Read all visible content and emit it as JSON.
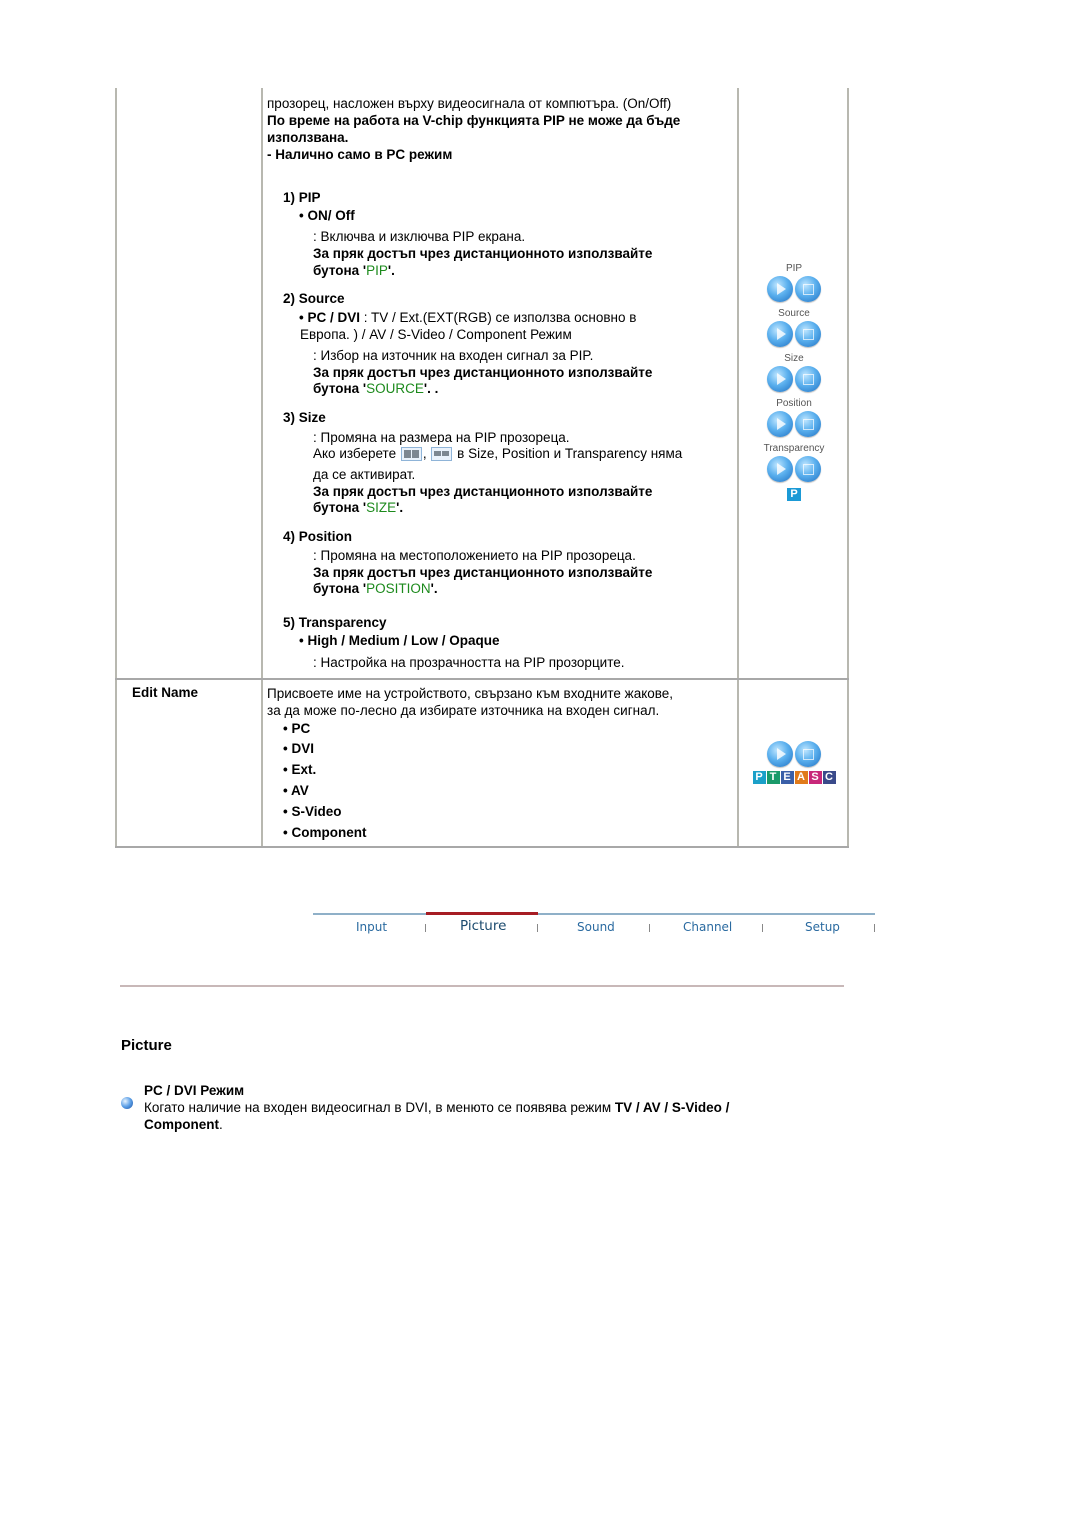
{
  "pip_row": {
    "intro_line": "прозорец, насложен върху видеосигнала от компютъра. (On/Off)",
    "warning_line1": "По време на работа на V-chip функцията PIP не може да бъде",
    "warning_line2": "използвана.",
    "pc_only": "- Налично само в PC режим",
    "sections": [
      {
        "heading": "1) PIP",
        "option": "• ON/ Off",
        "desc": ": Включва и изключва PIP екрана.",
        "remote_line1": "За пряк достъп чрез дистанционното използвайте",
        "remote_prefix": "бутона '",
        "remote_key": "PIP",
        "remote_suffix": "'."
      },
      {
        "heading": "2) Source",
        "option_bold": "• PC / DVI",
        "option_rest": " : TV / Ext.(EXT(RGB) се използва основно в",
        "option_line2": "Европа. ) / AV / S-Video / Component Режим",
        "desc": ": Избор на източник на входен сигнал за PIP.",
        "remote_line1": "За пряк достъп чрез дистанционното използвайте",
        "remote_prefix": "бутона '",
        "remote_key": "SOURCE",
        "remote_suffix": "'. ."
      },
      {
        "heading": "3) Size",
        "desc": ": Промяна на размера на PIP прозореца.",
        "note_prefix": "Ако изберете",
        "note_sep": ",",
        "note_suffix": "в Size, Position и Transparency няма",
        "note_line2": "да се активират.",
        "remote_line1": "За пряк достъп чрез дистанционното използвайте",
        "remote_prefix": "бутона '",
        "remote_key": "SIZE",
        "remote_suffix": "'."
      },
      {
        "heading": "4) Position",
        "desc": ": Промяна на местоположението на PIP прозореца.",
        "remote_line1": "За пряк достъп чрез дистанционното използвайте",
        "remote_prefix": "бутона '",
        "remote_key": "POSITION",
        "remote_suffix": "'."
      },
      {
        "heading": "5) Transparency",
        "option": "• High / Medium / Low / Opaque",
        "desc": ": Настройка на прозрачността на PIP прозорците."
      }
    ],
    "side_buttons": [
      {
        "label": "PIP"
      },
      {
        "label": "Source"
      },
      {
        "label": "Size"
      },
      {
        "label": "Position"
      },
      {
        "label": "Transparency"
      }
    ],
    "remote_badge": "P"
  },
  "edit_name_row": {
    "label": "Edit Name",
    "desc_line1": "Присвоете име на устройството, свързано към входните жакове,",
    "desc_line2": "за да може по-лесно да избирате източника на входен сигнал.",
    "items": [
      "• PC",
      "• DVI",
      "• Ext.",
      "• AV",
      "• S-Video",
      "• Component"
    ],
    "badge_letters": [
      {
        "letter": "P",
        "color": "#1ba0c8"
      },
      {
        "letter": "T",
        "color": "#1a9a6a"
      },
      {
        "letter": "E",
        "color": "#3a5fa8"
      },
      {
        "letter": "A",
        "color": "#e07a1a"
      },
      {
        "letter": "S",
        "color": "#c8287a"
      },
      {
        "letter": "C",
        "color": "#3a4a8a"
      }
    ]
  },
  "nav": {
    "tabs": [
      "Input",
      "Picture",
      "Sound",
      "Channel",
      "Setup"
    ],
    "active": "Picture",
    "accent_color": "#a61c23"
  },
  "picture_section": {
    "title": "Picture",
    "subtitle": "PC / DVI Режим",
    "text_plain": "Когато наличие на входен видеосигнал в DVI, в менюто се появява режим ",
    "text_bold1": "TV / AV / S-Video /",
    "text_bold2": "Component",
    "text_end": "."
  }
}
